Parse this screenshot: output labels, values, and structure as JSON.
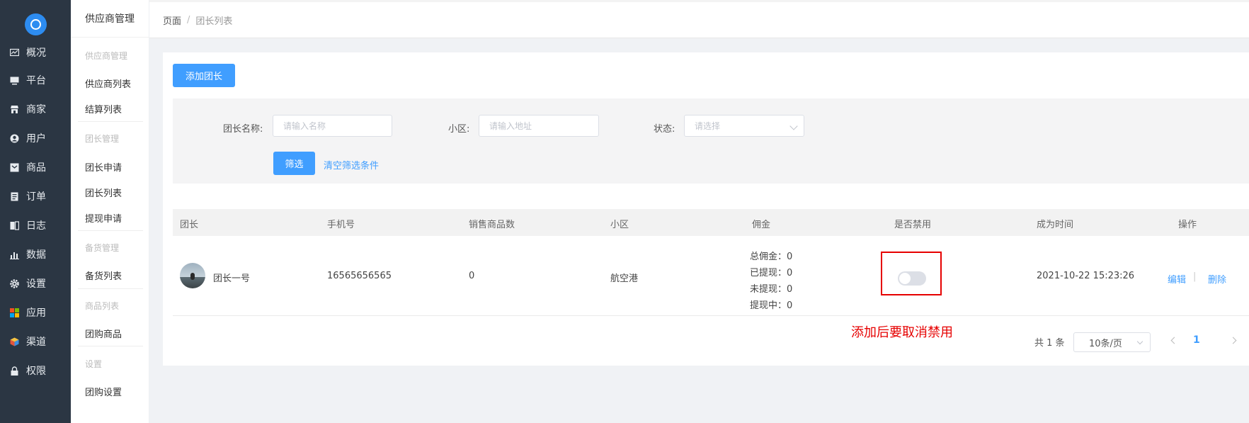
{
  "nav": {
    "items": [
      {
        "label": "概况",
        "icon": "chart-icon"
      },
      {
        "label": "平台",
        "icon": "monitor-icon"
      },
      {
        "label": "商家",
        "icon": "store-icon"
      },
      {
        "label": "用户",
        "icon": "user-icon"
      },
      {
        "label": "商品",
        "icon": "product-icon"
      },
      {
        "label": "订单",
        "icon": "order-icon"
      },
      {
        "label": "日志",
        "icon": "log-icon"
      },
      {
        "label": "数据",
        "icon": "bar-chart-icon"
      },
      {
        "label": "设置",
        "icon": "gear-icon"
      },
      {
        "label": "应用",
        "icon": "apps-icon"
      },
      {
        "label": "渠道",
        "icon": "cube-icon"
      },
      {
        "label": "权限",
        "icon": "lock-icon"
      }
    ]
  },
  "subnav": {
    "title": "供应商管理",
    "groups": [
      {
        "title": "供应商管理",
        "items": [
          "供应商列表",
          "结算列表"
        ]
      },
      {
        "title": "团长管理",
        "items": [
          "团长申请",
          "团长列表",
          "提现申请"
        ]
      },
      {
        "title": "备货管理",
        "items": [
          "备货列表"
        ]
      },
      {
        "title": "商品列表",
        "items": [
          "团购商品"
        ]
      },
      {
        "title": "设置",
        "items": [
          "团购设置"
        ]
      }
    ]
  },
  "breadcrumb": {
    "root": "页面",
    "separator": "/",
    "current": "团长列表"
  },
  "toolbar": {
    "add_label": "添加团长"
  },
  "filter": {
    "name_label": "团长名称:",
    "name_placeholder": "请输入名称",
    "community_label": "小区:",
    "community_placeholder": "请输入地址",
    "status_label": "状态:",
    "status_placeholder": "请选择",
    "submit_label": "筛选",
    "clear_label": "清空筛选条件"
  },
  "table": {
    "columns": [
      "团长",
      "手机号",
      "销售商品数",
      "小区",
      "佣金",
      "是否禁用",
      "成为时间",
      "操作"
    ],
    "rows": [
      {
        "name": "团长一号",
        "phone": "16565656565",
        "sales": "0",
        "community": "航空港",
        "commission": [
          "总佣金：0",
          "已提现：0",
          "未提现：0",
          "提现中：0"
        ],
        "disabled": false,
        "joined": "2021-10-22 15:23:26",
        "edit_label": "编辑",
        "op_separator": "|",
        "delete_label": "删除"
      }
    ]
  },
  "annotation": "添加后要取消禁用",
  "pagination": {
    "total": "共 1 条",
    "page_size": "10条/页",
    "current": "1"
  },
  "colors": {
    "primary": "#409eff",
    "sidebar": "#2b3643",
    "annotation": "#e60000"
  }
}
